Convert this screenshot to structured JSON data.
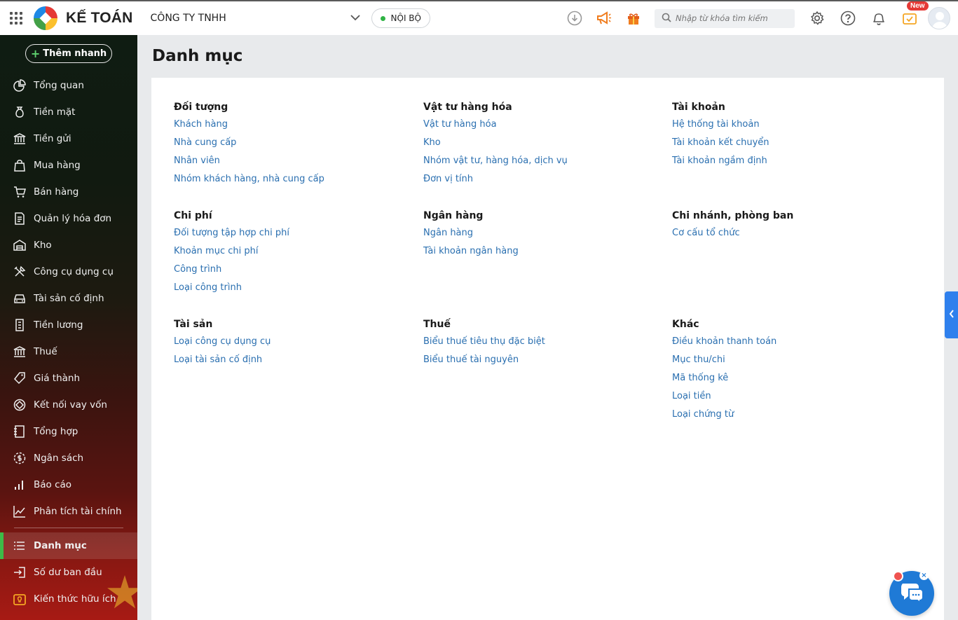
{
  "header": {
    "brand": "KẾ TOÁN",
    "company": "CÔNG TY TNHH",
    "environment": "NỘI BỘ",
    "search_placeholder": "Nhập từ khóa tìm kiếm",
    "new_badge": "New",
    "accent": "#2fb344"
  },
  "sidebar": {
    "quick_add": "Thêm nhanh",
    "items": [
      {
        "label": "Tổng quan",
        "icon": "chart-pie-icon"
      },
      {
        "label": "Tiền mặt",
        "icon": "money-bag-icon"
      },
      {
        "label": "Tiền gửi",
        "icon": "bank-icon"
      },
      {
        "label": "Mua hàng",
        "icon": "shopping-bag-icon"
      },
      {
        "label": "Bán hàng",
        "icon": "cart-icon"
      },
      {
        "label": "Quản lý hóa đơn",
        "icon": "invoice-icon"
      },
      {
        "label": "Kho",
        "icon": "warehouse-icon"
      },
      {
        "label": "Công cụ dụng cụ",
        "icon": "tools-icon"
      },
      {
        "label": "Tài sản cố định",
        "icon": "car-icon"
      },
      {
        "label": "Tiền lương",
        "icon": "payroll-icon"
      },
      {
        "label": "Thuế",
        "icon": "tax-building-icon"
      },
      {
        "label": "Giá thành",
        "icon": "price-tag-icon"
      },
      {
        "label": "Kết nối vay vốn",
        "icon": "loan-icon"
      },
      {
        "label": "Tổng hợp",
        "icon": "ledger-icon"
      },
      {
        "label": "Ngân sách",
        "icon": "budget-icon"
      },
      {
        "label": "Báo cáo",
        "icon": "bar-chart-icon"
      },
      {
        "label": "Phân tích tài chính",
        "icon": "line-chart-icon"
      }
    ],
    "bottom_items": [
      {
        "label": "Danh mục",
        "icon": "list-icon",
        "active": true
      },
      {
        "label": "Số dư ban đầu",
        "icon": "import-icon"
      },
      {
        "label": "Kiến thức hữu ích",
        "icon": "knowledge-icon"
      }
    ]
  },
  "main": {
    "title": "Danh mục",
    "groups": [
      {
        "title": "Đối tượng",
        "links": [
          "Khách hàng",
          "Nhà cung cấp",
          "Nhân viên",
          "Nhóm khách hàng, nhà cung cấp"
        ]
      },
      {
        "title": "Vật tư hàng hóa",
        "links": [
          "Vật tư hàng hóa",
          "Kho",
          "Nhóm vật tư, hàng hóa, dịch vụ",
          "Đơn vị tính"
        ]
      },
      {
        "title": "Tài khoản",
        "links": [
          "Hệ thống tài khoản",
          "Tài khoản kết chuyển",
          "Tài khoản ngầm định"
        ]
      },
      {
        "title": "Chi phí",
        "links": [
          "Đối tượng tập hợp chi phí",
          "Khoản mục chi phí",
          "Công trình",
          "Loại công trình"
        ]
      },
      {
        "title": "Ngân hàng",
        "links": [
          "Ngân hàng",
          "Tài khoản ngân hàng"
        ]
      },
      {
        "title": "Chi nhánh, phòng ban",
        "links": [
          "Cơ cấu tổ chức"
        ]
      },
      {
        "title": "Tài sản",
        "links": [
          "Loại công cụ dụng cụ",
          "Loại tài sản cố định"
        ]
      },
      {
        "title": "Thuế",
        "links": [
          "Biểu thuế tiêu thụ đặc biệt",
          "Biểu thuế tài nguyên"
        ]
      },
      {
        "title": "Khác",
        "links": [
          "Điều khoản thanh toán",
          "Mục thu/chi",
          "Mã thống kê",
          "Loại tiền",
          "Loại chứng từ"
        ]
      }
    ],
    "link_color": "#2a6fb0"
  }
}
